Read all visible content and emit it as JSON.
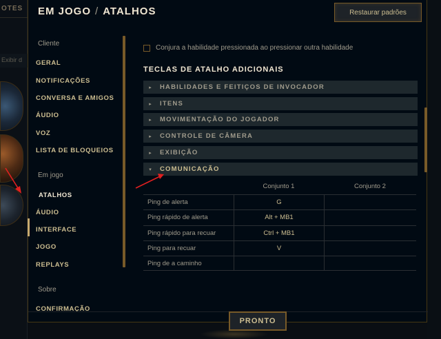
{
  "background": {
    "tab_partial": "OTES",
    "field_partial": "Exibir d"
  },
  "header": {
    "section": "EM JOGO",
    "separator": "/",
    "page": "ATALHOS",
    "restore_label": "Restaurar padrões"
  },
  "sidebar": {
    "groups": [
      {
        "label": "Cliente",
        "items": [
          "GERAL",
          "NOTIFICAÇÕES",
          "CONVERSA E AMIGOS",
          "ÁUDIO",
          "VOZ",
          "LISTA DE BLOQUEIOS"
        ]
      },
      {
        "label": "Em jogo",
        "items": [
          "ATALHOS",
          "ÁUDIO",
          "INTERFACE",
          "JOGO",
          "REPLAYS"
        ]
      },
      {
        "label": "Sobre",
        "items": [
          "CONFIRMAÇÃO"
        ]
      }
    ],
    "active_item": "ATALHOS"
  },
  "content": {
    "checkbox_label": "Conjura a habilidade pressionada ao pressionar outra habilidade",
    "checkbox_checked": false,
    "section_title": "TECLAS DE ATALHO ADICIONAIS",
    "categories": [
      {
        "label": "HABILIDADES E FEITIÇOS DE INVOCADOR",
        "expanded": false
      },
      {
        "label": "ITENS",
        "expanded": false
      },
      {
        "label": "MOVIMENTAÇÃO DO JOGADOR",
        "expanded": false
      },
      {
        "label": "CONTROLE DE CÂMERA",
        "expanded": false
      },
      {
        "label": "EXIBIÇÃO",
        "expanded": false
      },
      {
        "label": "COMUNICAÇÃO",
        "expanded": true
      }
    ],
    "columns": [
      "Conjunto 1",
      "Conjunto 2"
    ],
    "rows": [
      {
        "name": "Ping de alerta",
        "set1": "G",
        "set2": ""
      },
      {
        "name": "Ping rápido de alerta",
        "set1": "Alt + MB1",
        "set2": ""
      },
      {
        "name": "Ping rápido para recuar",
        "set1": "Ctrl + MB1",
        "set2": ""
      },
      {
        "name": "Ping para recuar",
        "set1": "V",
        "set2": ""
      },
      {
        "name": "Ping de a caminho",
        "set1": "",
        "set2": ""
      }
    ]
  },
  "footer": {
    "ok_label": "PRONTO"
  },
  "colors": {
    "gold": "#c8aa6e",
    "annotation_red": "#e02020",
    "panel_bg": "#010a13"
  }
}
